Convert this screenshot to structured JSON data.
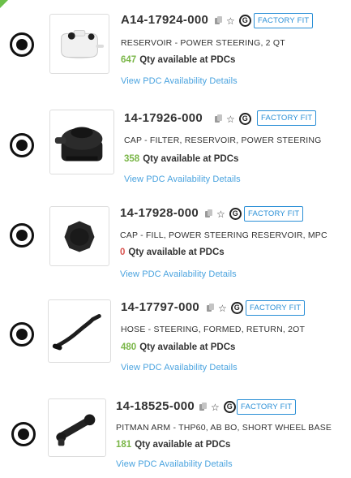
{
  "colors": {
    "accent": "#2a8fd6",
    "link": "#4aa3df",
    "qty_available": "#7ab648",
    "qty_zero": "#d9534f"
  },
  "icons": [
    "copy-icon",
    "star-icon",
    "genuine-g-icon",
    "radio-selected-icon"
  ],
  "parts": [
    {
      "part_number": "A14-17924-000",
      "badge": "FACTORY FIT",
      "description": "RESERVOIR - POWER STEERING, 2 QT",
      "qty": "647",
      "qty_status": "available",
      "qty_text": "Qty available at PDCs",
      "details_link": "View PDC Availability Details"
    },
    {
      "part_number": "14-17926-000",
      "badge": "FACTORY FIT",
      "description": "CAP - FILTER, RESERVOIR, POWER STEERING",
      "qty": "358",
      "qty_status": "available",
      "qty_text": "Qty available at PDCs",
      "details_link": "View PDC Availability Details"
    },
    {
      "part_number": "14-17928-000",
      "badge": "FACTORY FIT",
      "description": "CAP - FILL, POWER STEERING RESERVOIR, MPC",
      "qty": "0",
      "qty_status": "zero",
      "qty_text": "Qty available at PDCs",
      "details_link": "View PDC Availability Details"
    },
    {
      "part_number": "14-17797-000",
      "badge": "FACTORY FIT",
      "description": "HOSE - STEERING, FORMED, RETURN, 2OT",
      "qty": "480",
      "qty_status": "available",
      "qty_text": "Qty available at PDCs",
      "details_link": "View PDC Availability Details"
    },
    {
      "part_number": "14-18525-000",
      "badge": "FACTORY FIT",
      "description": "PITMAN ARM - THP60, AB BO, SHORT WHEEL BASE",
      "qty": "181",
      "qty_status": "available",
      "qty_text": "Qty available at PDCs",
      "details_link": "View PDC Availability Details"
    }
  ]
}
